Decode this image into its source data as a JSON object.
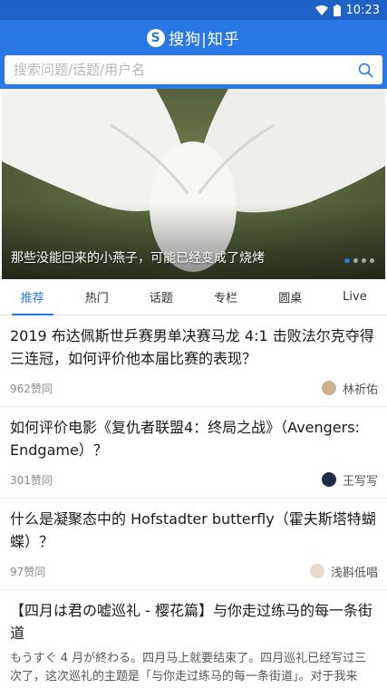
{
  "status_bar": {
    "time": "10:23"
  },
  "header": {
    "brand": "搜狗|知乎",
    "search": {
      "placeholder": "搜索问题/话题/用户名"
    }
  },
  "banner": {
    "caption": "那些没能回来的小燕子，可能已经变成了烧烤",
    "slide_count": 4,
    "active_slide": 1
  },
  "tabs": [
    {
      "label": "推荐",
      "active": true
    },
    {
      "label": "热门"
    },
    {
      "label": "话题"
    },
    {
      "label": "专栏"
    },
    {
      "label": "圆桌"
    },
    {
      "label": "Live"
    }
  ],
  "feed": [
    {
      "title": "2019 布达佩斯世乒赛男单决赛马龙 4:1 击败法尔克夺得三连冠，如何评价他本届比赛的表现？",
      "likes": "962赞同",
      "author": "林祈佑",
      "avatar_color": "#c9b48a"
    },
    {
      "title": "如何评价电影《复仇者联盟4：终局之战》（Avengers: Endgame）？",
      "likes": "301赞同",
      "author": "王写写",
      "avatar_color": "#1f2c4a"
    },
    {
      "title": "什么是凝聚态中的 Hofstadter butterfly（霍夫斯塔特蝴蝶）？",
      "likes": "97赞同",
      "author": "浅斟低唱",
      "avatar_color": "#e8d9c8"
    },
    {
      "title": "【四月は君の嘘巡礼 - 樱花篇】与你走过练马的每一条街道",
      "excerpt": "もうすぐ 4 月が終わる。四月马上就要结束了。四月巡礼已经写过三次了，这次巡礼的主题是「与你走过练马的每一条街道」。对于我来说，练"
    }
  ],
  "colors": {
    "brand_blue": "#2a78e6",
    "status_blue": "#1f62c6"
  }
}
